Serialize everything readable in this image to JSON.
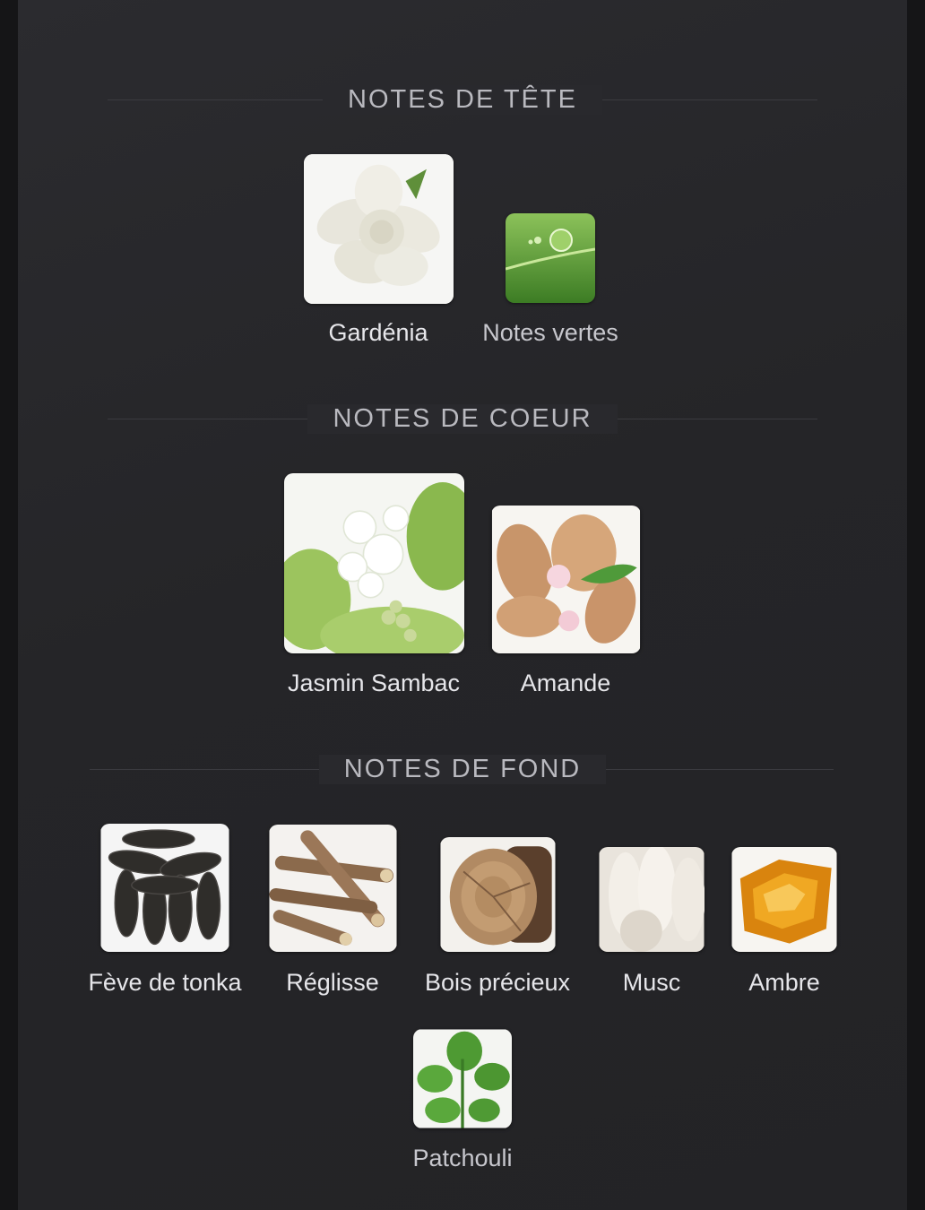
{
  "sections": [
    {
      "title": "NOTES DE TÊTE",
      "notes": [
        {
          "label": "Gardénia",
          "icon": "gardenia-image"
        },
        {
          "label": "Notes vertes",
          "icon": "green-notes-image"
        }
      ]
    },
    {
      "title": "NOTES DE COEUR",
      "notes": [
        {
          "label": "Jasmin Sambac",
          "icon": "jasmine-image"
        },
        {
          "label": "Amande",
          "icon": "almond-image"
        }
      ]
    },
    {
      "title": "NOTES DE FOND",
      "notes": [
        {
          "label": "Fève de tonka",
          "icon": "tonka-bean-image"
        },
        {
          "label": "Réglisse",
          "icon": "licorice-image"
        },
        {
          "label": "Bois précieux",
          "icon": "precious-wood-image"
        },
        {
          "label": "Musc",
          "icon": "musk-image"
        },
        {
          "label": "Ambre",
          "icon": "amber-image"
        },
        {
          "label": "Patchouli",
          "icon": "patchouli-image"
        }
      ]
    }
  ],
  "colors": {
    "background": "#252528",
    "heading": "#b9b9bf",
    "label": "#e6e6ea"
  }
}
